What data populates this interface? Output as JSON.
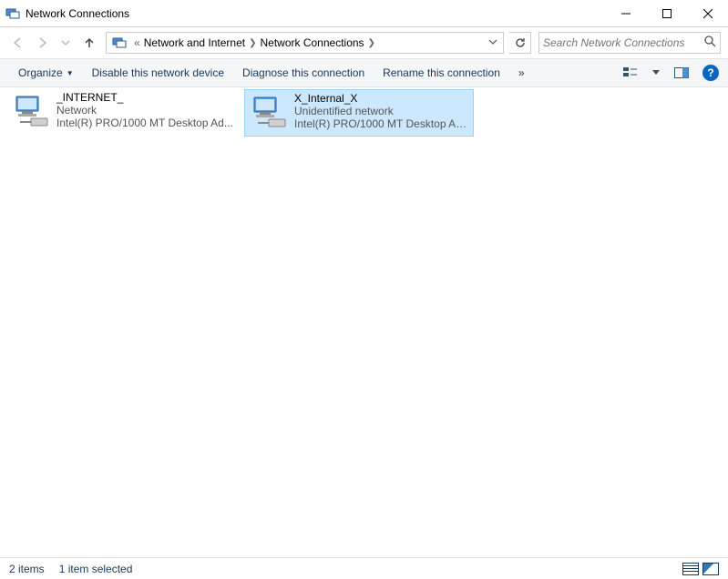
{
  "window": {
    "title": "Network Connections"
  },
  "breadcrumb": {
    "prefix": "«",
    "items": [
      "Network and Internet",
      "Network Connections"
    ]
  },
  "search": {
    "placeholder": "Search Network Connections"
  },
  "toolbar": {
    "organize": "Organize",
    "disable": "Disable this network device",
    "diagnose": "Diagnose this connection",
    "rename": "Rename this connection",
    "more": "»"
  },
  "connections": [
    {
      "name": "_INTERNET_",
      "status": "Network",
      "adapter": "Intel(R) PRO/1000 MT Desktop Ad...",
      "selected": false
    },
    {
      "name": "X_Internal_X",
      "status": "Unidentified network",
      "adapter": "Intel(R) PRO/1000 MT Desktop Ad...",
      "selected": true
    }
  ],
  "statusbar": {
    "items": "2 items",
    "selected": "1 item selected"
  }
}
